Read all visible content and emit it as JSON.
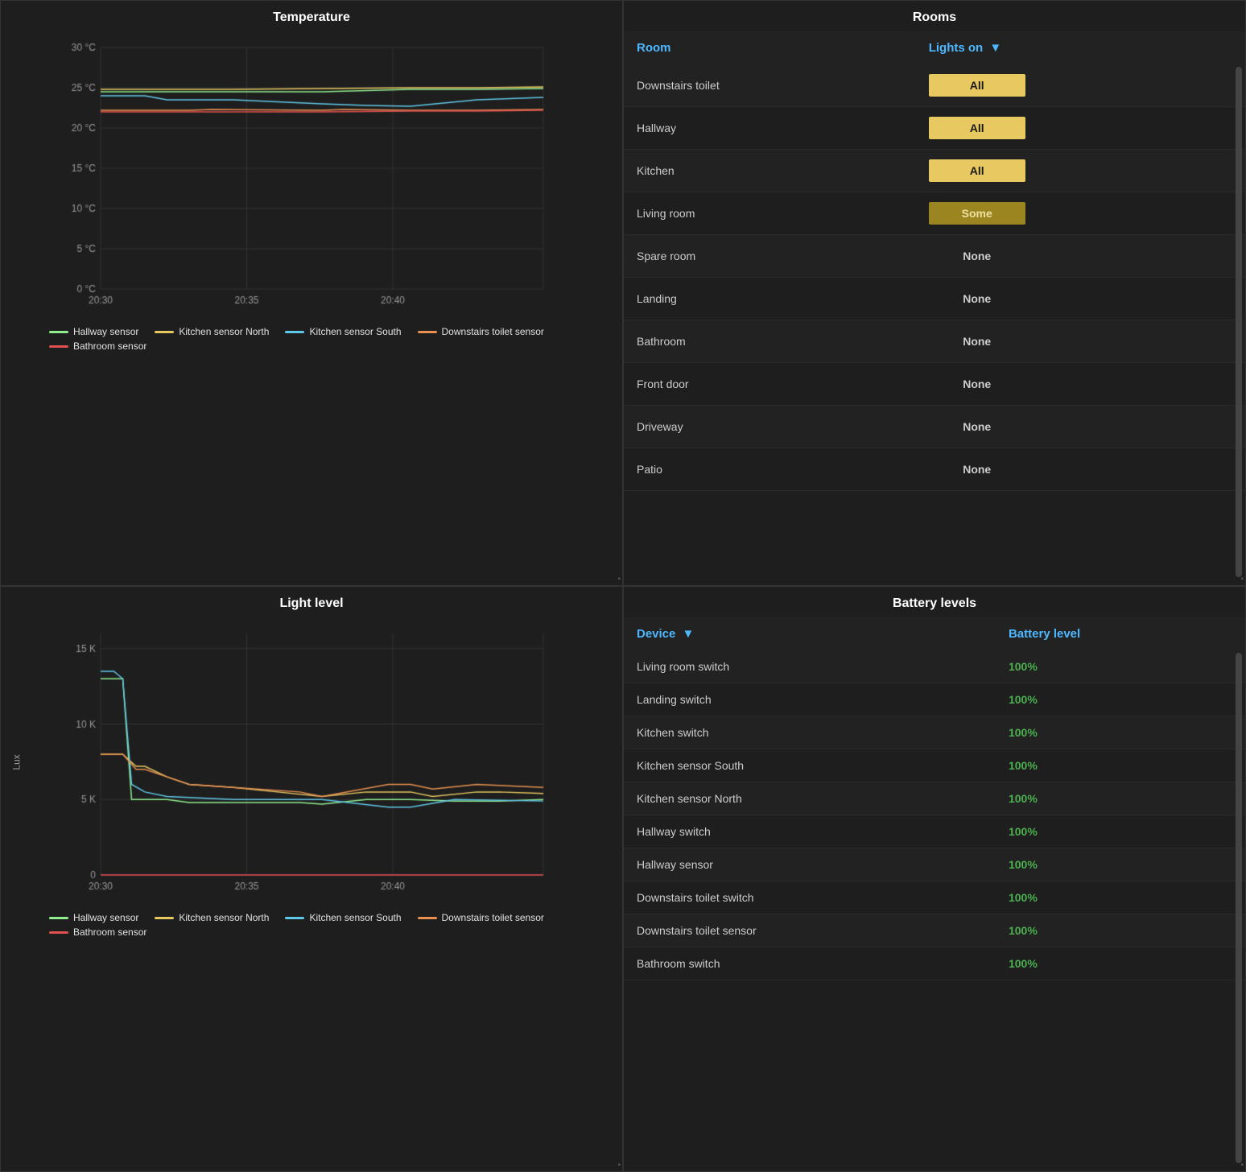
{
  "temperature_chart": {
    "title": "Temperature",
    "y_labels": [
      "30 °C",
      "25 °C",
      "20 °C",
      "15 °C",
      "10 °C",
      "5 °C",
      "0 °C"
    ],
    "x_labels": [
      "20:30",
      "20:35",
      "20:40"
    ],
    "legend": [
      {
        "label": "Hallway sensor",
        "color": "#90ee90"
      },
      {
        "label": "Kitchen sensor North",
        "color": "#e8c860"
      },
      {
        "label": "Kitchen sensor South",
        "color": "#60c8e8"
      },
      {
        "label": "Downstairs toilet sensor",
        "color": "#e89050"
      },
      {
        "label": "Bathroom sensor",
        "color": "#e05050"
      }
    ]
  },
  "light_chart": {
    "title": "Light level",
    "y_labels": [
      "15 K",
      "10 K",
      "5 K",
      "0"
    ],
    "x_labels": [
      "20:30",
      "20:35",
      "20:40"
    ],
    "y_axis_label": "Lux",
    "legend": [
      {
        "label": "Hallway sensor",
        "color": "#90ee90"
      },
      {
        "label": "Kitchen sensor North",
        "color": "#e8c860"
      },
      {
        "label": "Kitchen sensor South",
        "color": "#60c8e8"
      },
      {
        "label": "Downstairs toilet sensor",
        "color": "#e89050"
      },
      {
        "label": "Bathroom sensor",
        "color": "#e05050"
      }
    ]
  },
  "rooms": {
    "title": "Rooms",
    "col_room": "Room",
    "col_lights": "Lights on",
    "rows": [
      {
        "room": "Downstairs toilet",
        "lights": "All",
        "status": "all"
      },
      {
        "room": "Hallway",
        "lights": "All",
        "status": "all"
      },
      {
        "room": "Kitchen",
        "lights": "All",
        "status": "all"
      },
      {
        "room": "Living room",
        "lights": "Some",
        "status": "some"
      },
      {
        "room": "Spare room",
        "lights": "None",
        "status": "none"
      },
      {
        "room": "Landing",
        "lights": "None",
        "status": "none"
      },
      {
        "room": "Bathroom",
        "lights": "None",
        "status": "none"
      },
      {
        "room": "Front door",
        "lights": "None",
        "status": "none"
      },
      {
        "room": "Driveway",
        "lights": "None",
        "status": "none"
      },
      {
        "room": "Patio",
        "lights": "None",
        "status": "none"
      }
    ]
  },
  "battery": {
    "title": "Battery levels",
    "col_device": "Device",
    "col_battery": "Battery level",
    "rows": [
      {
        "device": "Living room switch",
        "level": "100%"
      },
      {
        "device": "Landing switch",
        "level": "100%"
      },
      {
        "device": "Kitchen switch",
        "level": "100%"
      },
      {
        "device": "Kitchen sensor South",
        "level": "100%"
      },
      {
        "device": "Kitchen sensor North",
        "level": "100%"
      },
      {
        "device": "Hallway switch",
        "level": "100%"
      },
      {
        "device": "Hallway sensor",
        "level": "100%"
      },
      {
        "device": "Downstairs toilet switch",
        "level": "100%"
      },
      {
        "device": "Downstairs toilet sensor",
        "level": "100%"
      },
      {
        "device": "Bathroom switch",
        "level": "100%"
      }
    ]
  }
}
